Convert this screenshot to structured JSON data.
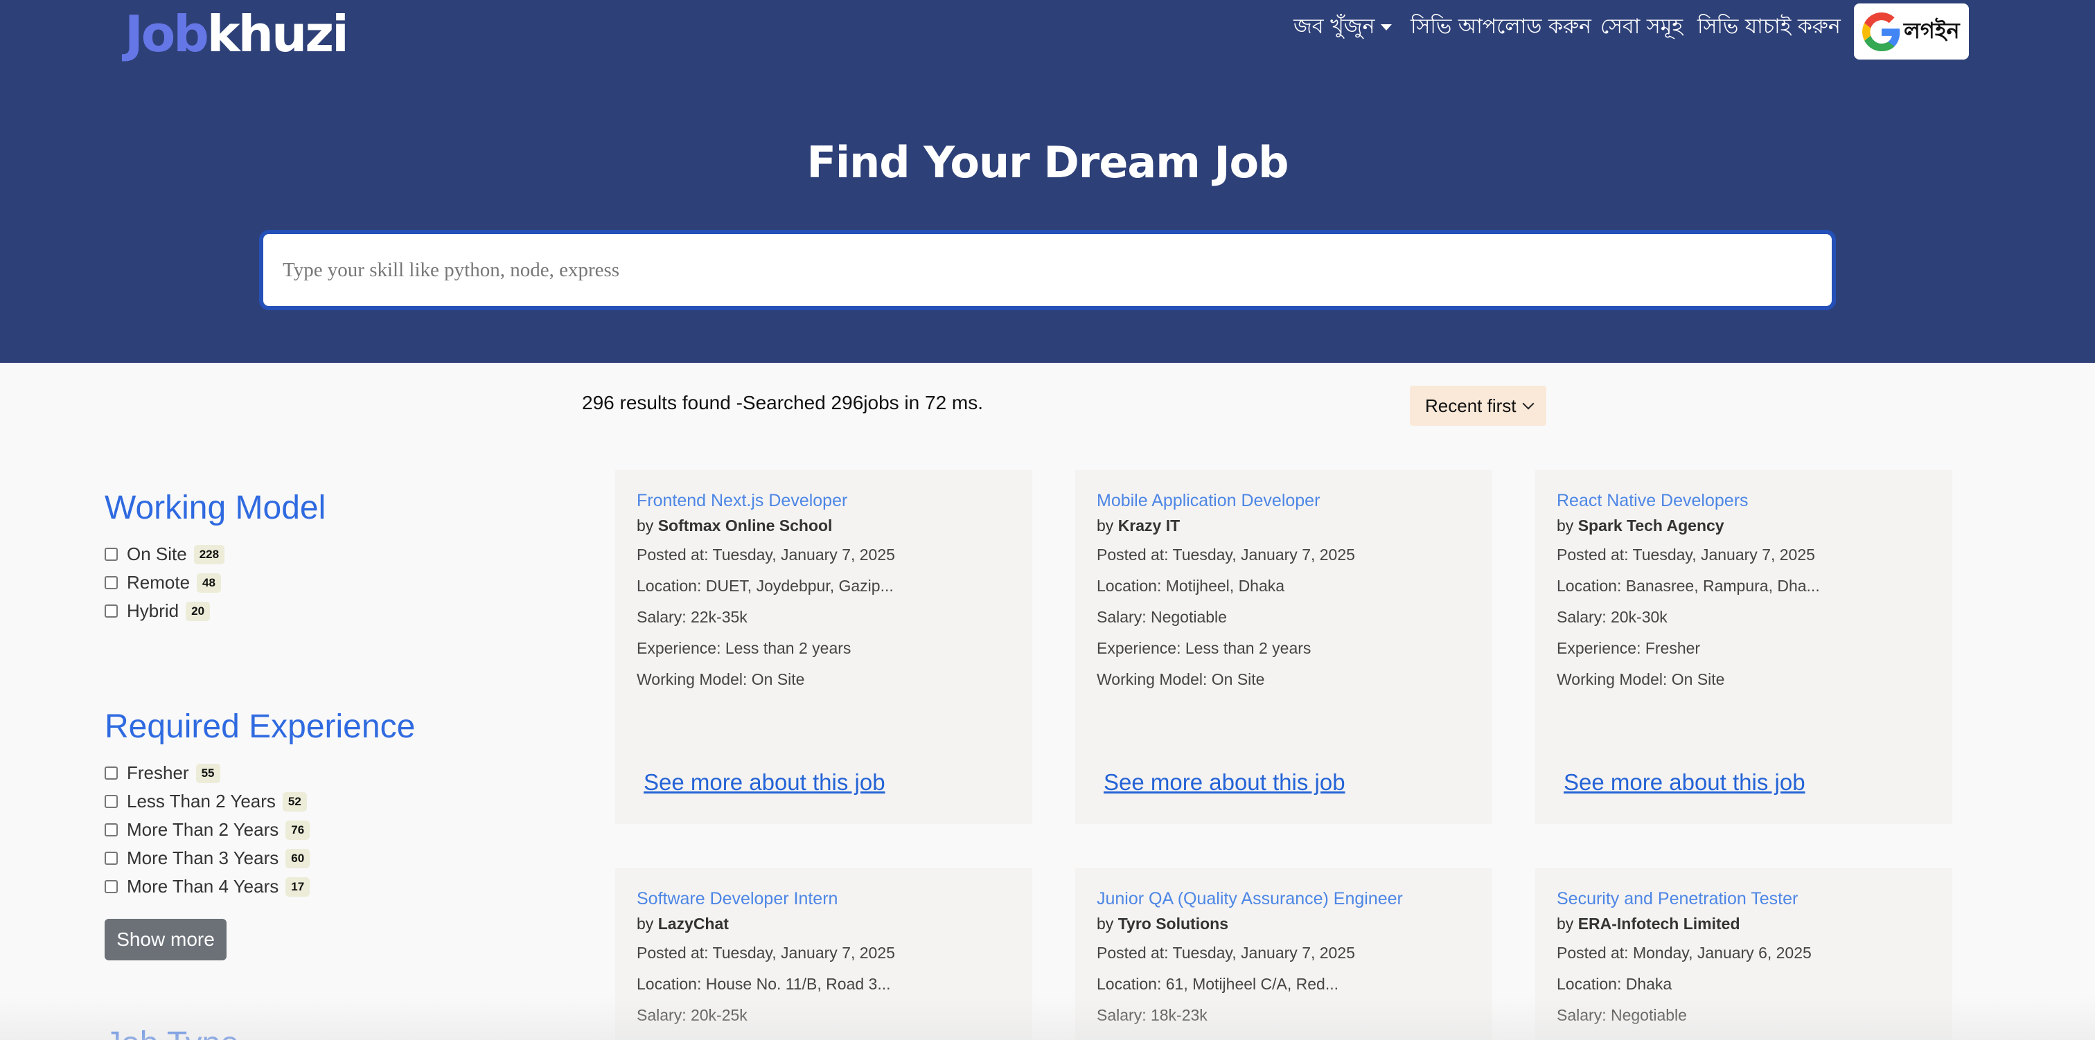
{
  "brand": {
    "logo_part1": "Job",
    "logo_part2": "khuzi"
  },
  "nav": {
    "find_jobs": "জব খুঁজুন",
    "upload_cv": "সিভি আপলোড করুন",
    "services": "সেবা সমূহ",
    "check_cv": "সিভি যাচাই করুন",
    "login": "লগইন"
  },
  "hero": {
    "title": "Find Your Dream Job",
    "search_placeholder": "Type your skill like python, node, express"
  },
  "results": {
    "summary": "296 results found -Searched 296jobs in 72 ms.",
    "sort_value": "Recent first"
  },
  "filters": {
    "working_model": {
      "title": "Working Model",
      "items": [
        {
          "label": "On Site",
          "count": "228"
        },
        {
          "label": "Remote",
          "count": "48"
        },
        {
          "label": "Hybrid",
          "count": "20"
        }
      ]
    },
    "experience": {
      "title": "Required Experience",
      "items": [
        {
          "label": "Fresher",
          "count": "55"
        },
        {
          "label": "Less Than 2 Years",
          "count": "52"
        },
        {
          "label": "More Than 2 Years",
          "count": "76"
        },
        {
          "label": "More Than 3 Years",
          "count": "60"
        },
        {
          "label": "More Than 4 Years",
          "count": "17"
        }
      ],
      "show_more": "Show more"
    },
    "job_type": {
      "title": "Job Type"
    }
  },
  "jobs": [
    {
      "title": "Frontend Next.js Developer",
      "by": "by ",
      "company": "Softmax Online School",
      "posted": "Posted at: Tuesday, January 7, 2025",
      "location": "Location: DUET, Joydebpur, Gazip...",
      "salary": "Salary: 22k-35k",
      "experience": "Experience: Less than 2 years",
      "working_model": "Working Model: On Site",
      "link": "See more about this job"
    },
    {
      "title": "Mobile Application Developer",
      "by": "by ",
      "company": "Krazy IT",
      "posted": "Posted at: Tuesday, January 7, 2025",
      "location": "Location: Motijheel, Dhaka",
      "salary": "Salary: Negotiable",
      "experience": "Experience: Less than 2 years",
      "working_model": "Working Model: On Site",
      "link": "See more about this job"
    },
    {
      "title": "React Native Developers",
      "by": "by ",
      "company": "Spark Tech Agency",
      "posted": "Posted at: Tuesday, January 7, 2025",
      "location": "Location: Banasree, Rampura, Dha...",
      "salary": "Salary: 20k-30k",
      "experience": "Experience: Fresher",
      "working_model": "Working Model: On Site",
      "link": "See more about this job"
    },
    {
      "title": "Software Developer Intern",
      "by": "by ",
      "company": "LazyChat",
      "posted": "Posted at: Tuesday, January 7, 2025",
      "location": "Location: House No. 11/B, Road 3...",
      "salary": "Salary: 20k-25k"
    },
    {
      "title": "Junior QA (Quality Assurance) Engineer",
      "by": "by ",
      "company": "Tyro Solutions",
      "posted": "Posted at: Tuesday, January 7, 2025",
      "location": "Location: 61, Motijheel C/A, Red...",
      "salary": "Salary: 18k-23k"
    },
    {
      "title": "Security and Penetration Tester",
      "by": "by ",
      "company": "ERA-Infotech Limited",
      "posted": "Posted at: Monday, January 6, 2025",
      "location": "Location: Dhaka",
      "salary": "Salary: Negotiable"
    }
  ]
}
